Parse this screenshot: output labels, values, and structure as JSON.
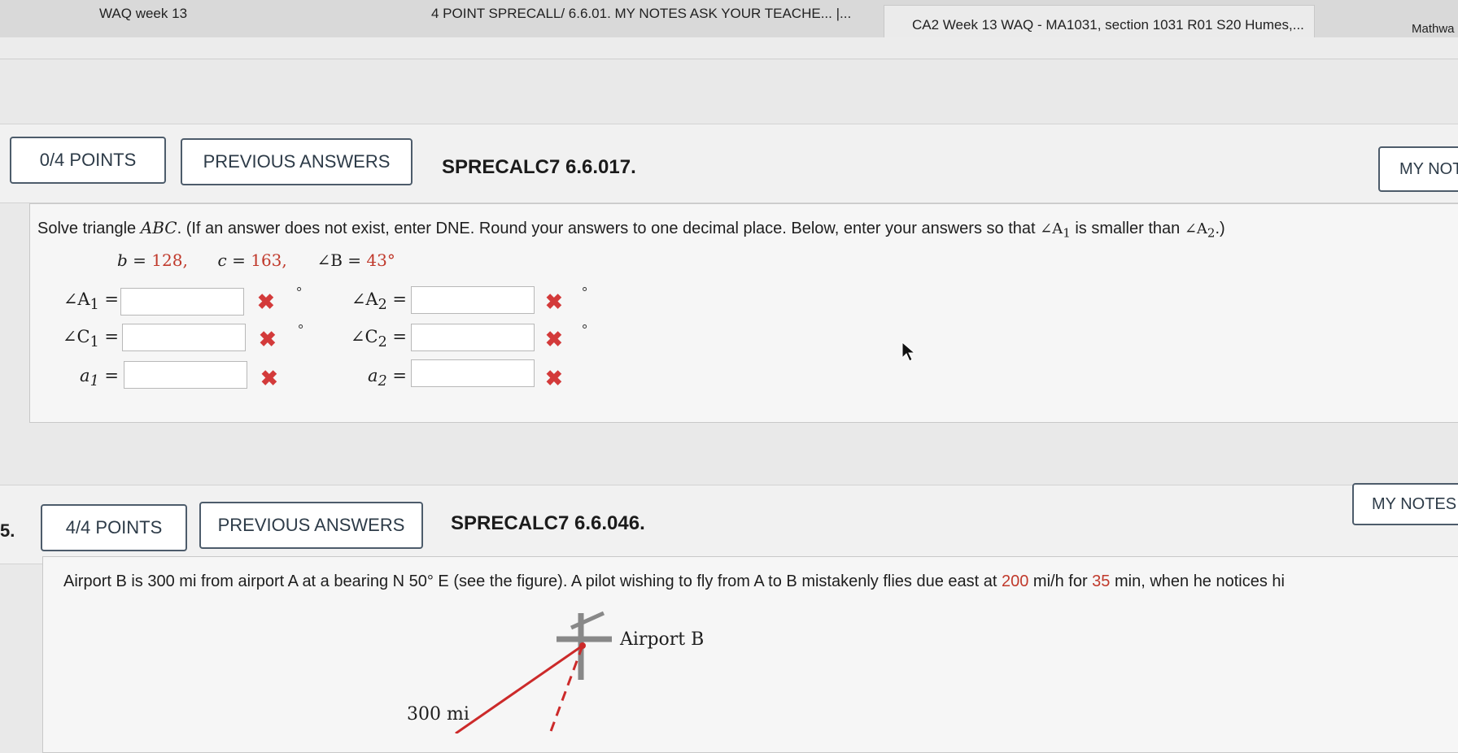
{
  "browser": {
    "tabs": [
      {
        "label": "WAQ week 13"
      },
      {
        "label": "4 POINT SPRECALL/ 6.6.01. MY NOTES ASK YOUR TEACHE... |..."
      },
      {
        "label": "CA2 Week 13 WAQ - MA1031, section 1031 R01 S20 Humes,..."
      },
      {
        "label": "Mathwa"
      }
    ]
  },
  "q4": {
    "points": "0/4 POINTS",
    "previous_answers": "PREVIOUS ANSWERS",
    "ref": "SPRECALC7 6.6.017.",
    "my_notes": "MY NOT",
    "instruction_pre": "Solve triangle ",
    "instruction_abc": "ABC",
    "instruction_mid": ". (If an answer does not exist, enter DNE. Round your answers to one decimal place. Below, enter your answers so that ",
    "instruction_a1": "∠A",
    "instruction_a1_sub": "1",
    "instruction_between": " is smaller than ",
    "instruction_a2": "∠A",
    "instruction_a2_sub": "2",
    "instruction_end": ".)",
    "given_b_label": "b = ",
    "given_b": "128,",
    "given_c_label": "c = ",
    "given_c": "163,",
    "given_B_label": "∠B = ",
    "given_B": "43°",
    "fields": [
      {
        "label": "∠A",
        "sub": "1",
        "eq": " =",
        "value": "",
        "unit": "°"
      },
      {
        "label": "∠A",
        "sub": "2",
        "eq": " =",
        "value": "",
        "unit": "°"
      },
      {
        "label": "∠C",
        "sub": "1",
        "eq": " =",
        "value": "",
        "unit": "°"
      },
      {
        "label": "∠C",
        "sub": "2",
        "eq": " =",
        "value": "",
        "unit": "°"
      },
      {
        "label": "a",
        "sub": "1",
        "eq": " =",
        "value": "",
        "unit": ""
      },
      {
        "label": "a",
        "sub": "2",
        "eq": " =",
        "value": "",
        "unit": ""
      }
    ],
    "wrong_mark": "✖"
  },
  "q5": {
    "number": "5.",
    "points": "4/4 POINTS",
    "previous_answers": "PREVIOUS ANSWERS",
    "ref": "SPRECALC7 6.6.046.",
    "my_notes": "MY NOTES",
    "text_pre": "Airport B is 300 mi from airport A at a bearing N 50° E (see the figure). A pilot wishing to fly from A to B mistakenly flies due east at ",
    "speed": "200",
    "text_mid": " mi/h for ",
    "time": "35",
    "text_end": " min, when he notices hi",
    "figure_airport_b": "Airport B",
    "figure_distance": "300 mi"
  },
  "colors": {
    "accent_red": "#c0392b",
    "button_border": "#4d5c6b"
  }
}
